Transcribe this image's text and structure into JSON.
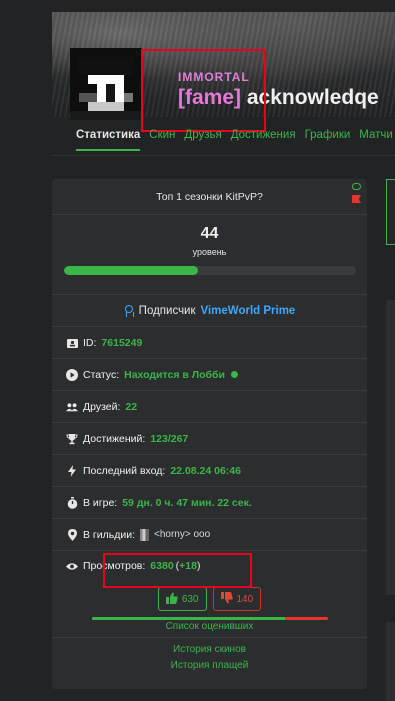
{
  "profile": {
    "rank": "IMMORTAL",
    "tag": "[fame]",
    "name": "acknowledqe"
  },
  "tabs": [
    "Статистика",
    "Скин",
    "Друзья",
    "Достижения",
    "Графики",
    "Матчи"
  ],
  "card": {
    "status_text": "Топ 1 сезонки KitPvP?",
    "level": "44",
    "level_label": "уровень",
    "level_progress": 0.46,
    "subscription_label": "Подписчик",
    "subscription_name": "VimeWorld Prime",
    "rows": {
      "id": {
        "label": "ID:",
        "value": "7615249"
      },
      "status": {
        "label": "Статус:",
        "value": "Находится в Лобби"
      },
      "friends": {
        "label": "Друзей:",
        "value": "22"
      },
      "achievements": {
        "label": "Достижений:",
        "value": "123/267"
      },
      "last_login": {
        "label": "Последний вход:",
        "value": "22.08.24 06:46"
      },
      "playtime": {
        "label": "В игре:",
        "value": "59 дн. 0 ч. 47 мин. 22 сек."
      },
      "guild": {
        "label": "В гильдии:",
        "value": "<horny> ooo"
      },
      "views": {
        "label": "Просмотров:",
        "value": "6380",
        "delta": "+18",
        "open": "(",
        "close": ")"
      }
    },
    "likes": "630",
    "dislikes": "140",
    "rated_list": "Список оценивших",
    "skin_history": "История скинов",
    "cape_history": "История плащей"
  },
  "colors": {
    "accent": "#3bb54a",
    "highlight": "#e8001d",
    "rank": "#e080d8",
    "prime": "#3da7ff"
  }
}
